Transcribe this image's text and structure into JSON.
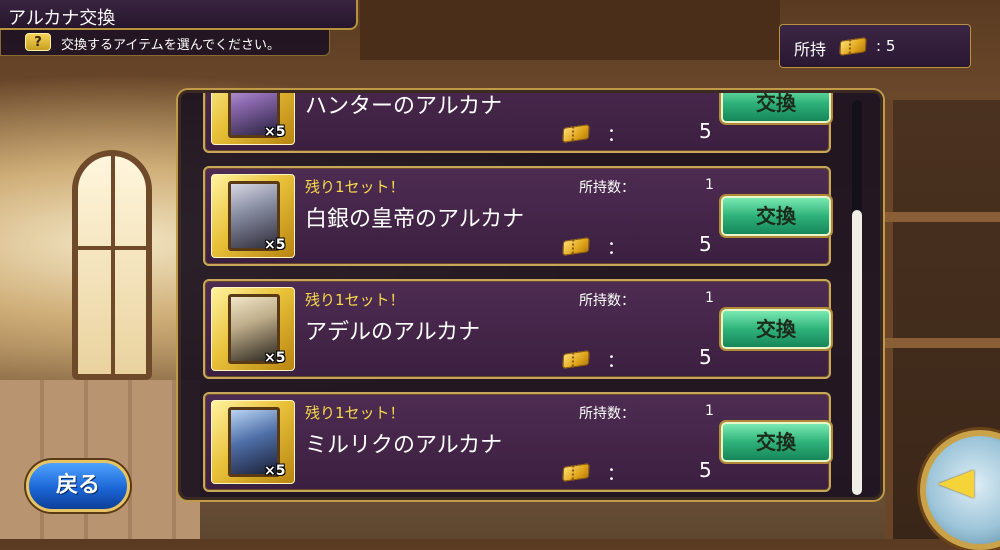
{
  "header": {
    "title": "アルカナ交換",
    "help_icon_label": "?",
    "instruction": "交換するアイテムを選んでください。"
  },
  "owned": {
    "label": "所持",
    "icon": "ticket-icon",
    "value": ":  5"
  },
  "list": {
    "owned_count_label": "所持数：",
    "cost_colon": "：",
    "exchange_label": "交換",
    "items": [
      {
        "name": "ハンターのアルカナ",
        "remaining": "",
        "owned_count": "",
        "card_count": "×5",
        "cost": "5",
        "partial": true
      },
      {
        "name": "白銀の皇帝のアルカナ",
        "remaining": "残り1セット！",
        "owned_count": "1",
        "card_count": "×5",
        "cost": "5"
      },
      {
        "name": "アデルのアルカナ",
        "remaining": "残り1セット！",
        "owned_count": "1",
        "card_count": "×5",
        "cost": "5"
      },
      {
        "name": "ミルリクのアルカナ",
        "remaining": "残り1セット！",
        "owned_count": "1",
        "card_count": "×5",
        "cost": "5"
      }
    ]
  },
  "footer": {
    "back_label": "戻る",
    "nav_icon": "arrow-left-icon"
  },
  "colors": {
    "accent_gold": "#c9a75a",
    "exchange_green": "#2fb27a",
    "back_blue": "#1b66d6",
    "remaining_yellow": "#f7d94a"
  }
}
